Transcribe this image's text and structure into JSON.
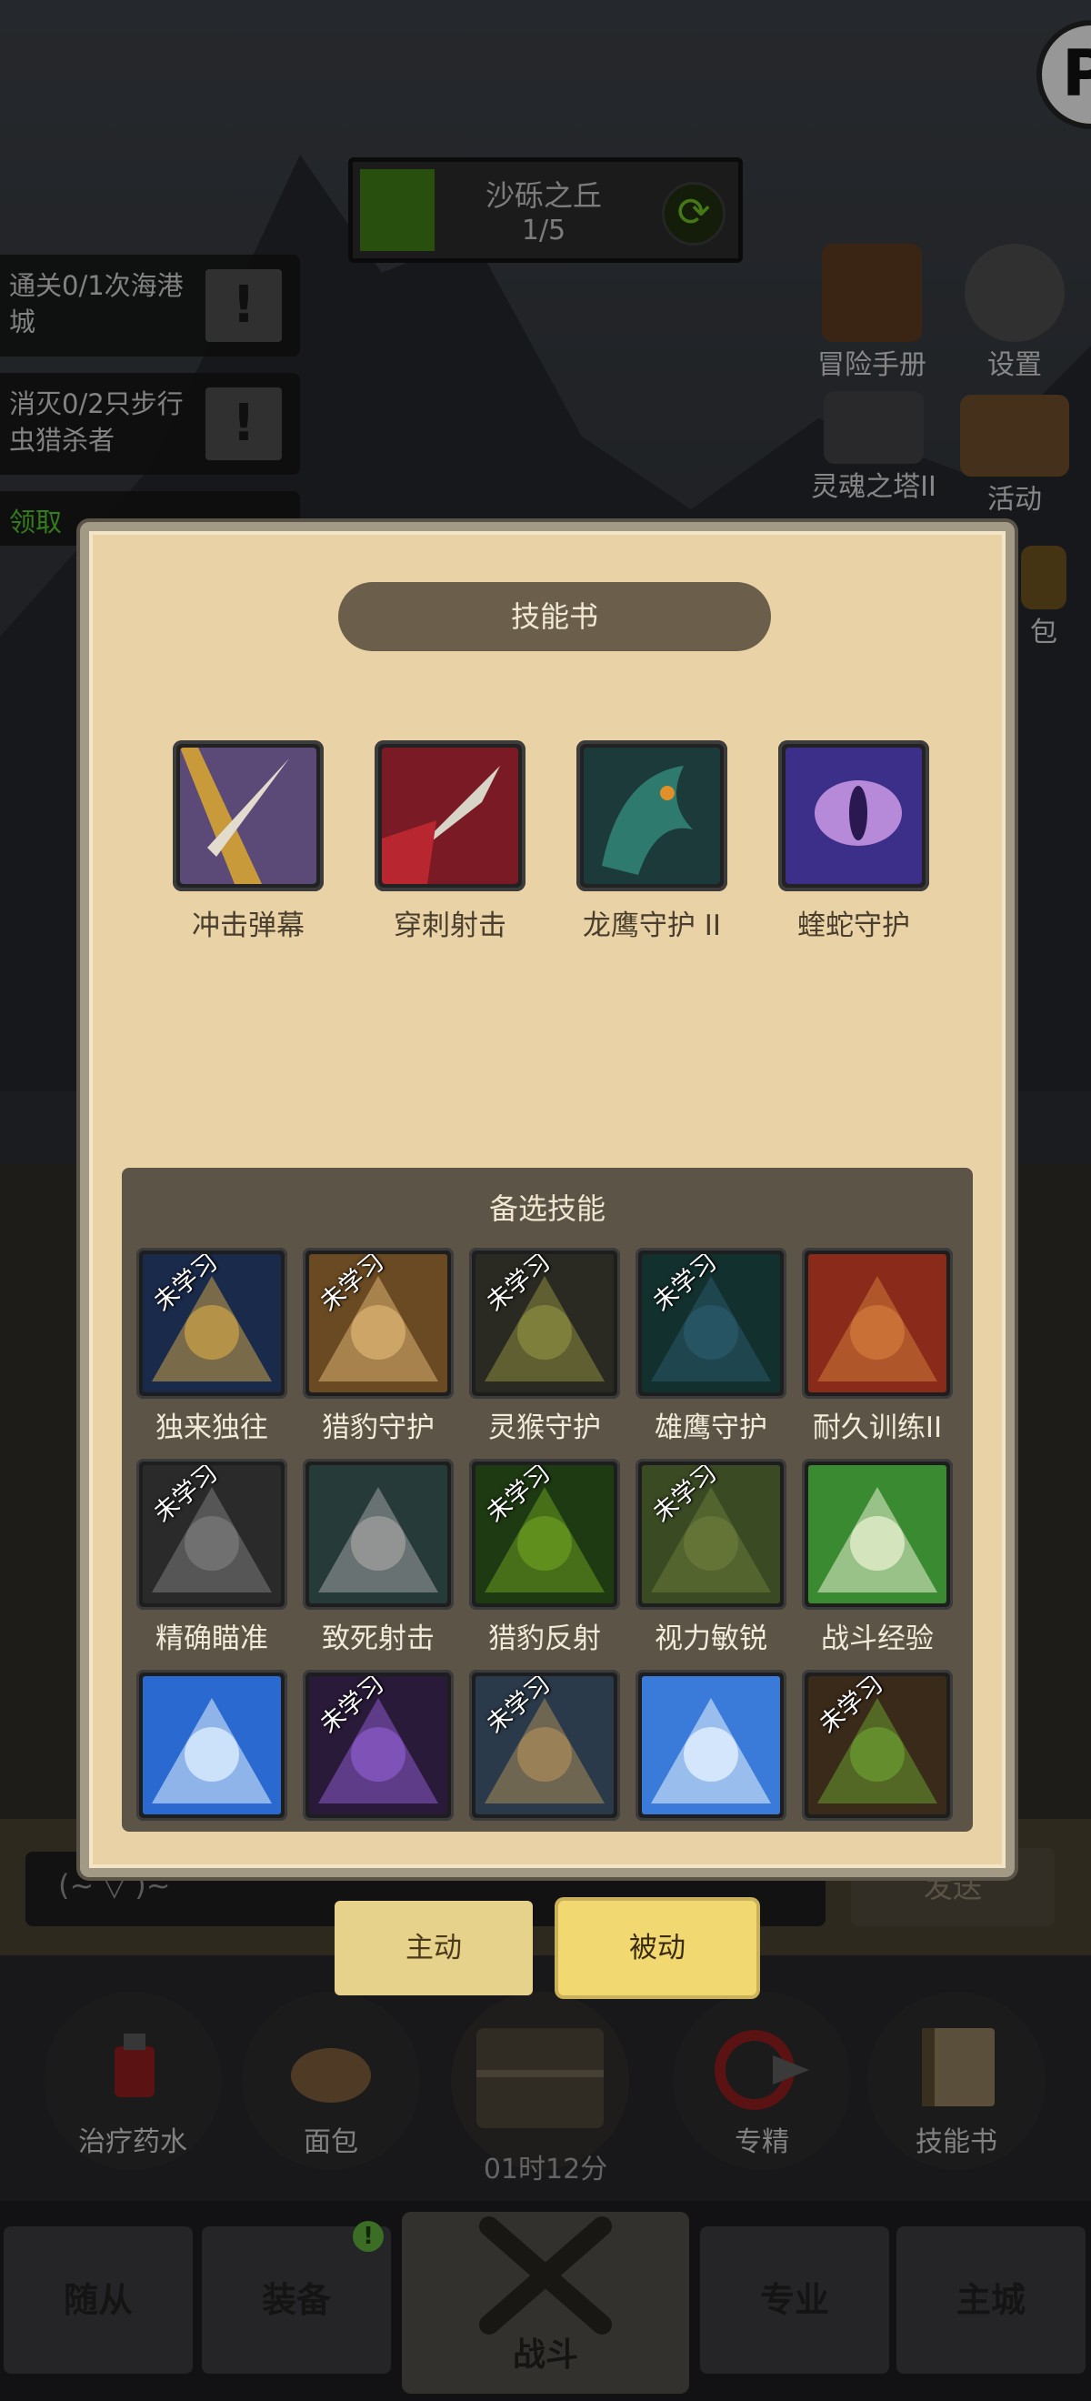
{
  "map": {
    "name": "沙砾之丘",
    "progress": "1/5"
  },
  "quests": [
    {
      "text": "通关0/1次海港城"
    },
    {
      "text": "消灭0/2只步行虫猎杀者"
    },
    {
      "text": "领取"
    }
  ],
  "hud": {
    "adventure_manual": "冒险手册",
    "settings": "设置",
    "soul_tower": "灵魂之塔II",
    "activity": "活动",
    "bag": "包"
  },
  "modal": {
    "title": "技能书",
    "equipped": [
      {
        "label": "冲击弹幕",
        "icon": "spear-tip-icon"
      },
      {
        "label": "穿刺射击",
        "icon": "piercing-arrow-icon"
      },
      {
        "label": "龙鹰守护 II",
        "icon": "dragonhawk-icon"
      },
      {
        "label": "蝰蛇守护",
        "icon": "viper-eye-icon"
      }
    ],
    "alternates_title": "备选技能",
    "unlearned_tag": "未学习",
    "alternates": [
      {
        "label": "独来独往",
        "unlearned": true,
        "icon": "lone-spear-icon"
      },
      {
        "label": "猎豹守护",
        "unlearned": true,
        "icon": "cheetah-icon"
      },
      {
        "label": "灵猴守护",
        "unlearned": true,
        "icon": "monkey-icon"
      },
      {
        "label": "雄鹰守护",
        "unlearned": true,
        "icon": "hawk-icon"
      },
      {
        "label": "耐久训练II",
        "unlearned": false,
        "icon": "strongman-icon"
      },
      {
        "label": "精确瞄准",
        "unlearned": true,
        "icon": "crosshair-icon"
      },
      {
        "label": "致死射击",
        "unlearned": false,
        "icon": "lethal-arrow-icon"
      },
      {
        "label": "猎豹反射",
        "unlearned": true,
        "icon": "claw-marks-icon"
      },
      {
        "label": "视力敏锐",
        "unlearned": true,
        "icon": "keen-eye-icon"
      },
      {
        "label": "战斗经验",
        "unlearned": false,
        "icon": "owl-icon"
      },
      {
        "label": "",
        "unlearned": false,
        "icon": "dash-icon"
      },
      {
        "label": "",
        "unlearned": true,
        "icon": "purple-arrow-icon"
      },
      {
        "label": "",
        "unlearned": true,
        "icon": "gryphon-icon"
      },
      {
        "label": "",
        "unlearned": false,
        "icon": "frost-shot-icon"
      },
      {
        "label": "",
        "unlearned": true,
        "icon": "trap-icon"
      }
    ]
  },
  "tabs": {
    "active": "主动",
    "passive": "被动"
  },
  "chat": {
    "emote": "(~  ▽  )~",
    "send": "发送"
  },
  "consumables": {
    "potion": "治疗药水",
    "bread": "面包",
    "specialization": "专精",
    "skill_book": "技能书",
    "timer": "01时12分"
  },
  "nav": {
    "followers": "随从",
    "equipment": "装备",
    "battle": "战斗",
    "profession": "专业",
    "main_city": "主城",
    "equipment_badge": "!"
  }
}
